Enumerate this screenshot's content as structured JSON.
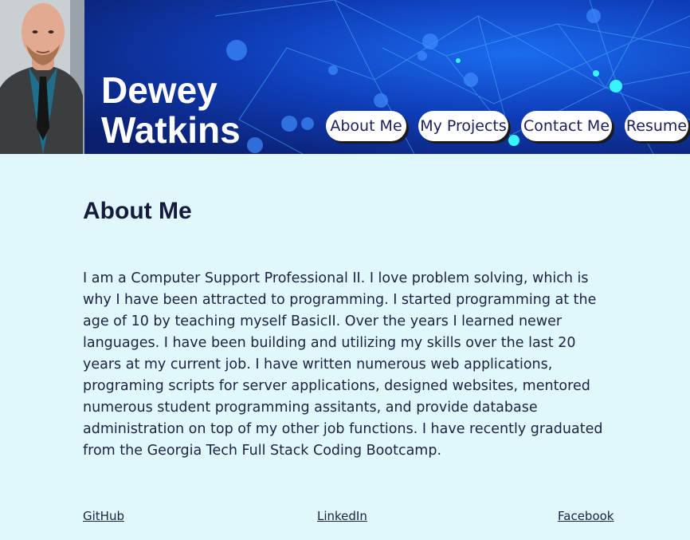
{
  "header": {
    "name_line1": "Dewey",
    "name_line2": "Watkins",
    "avatar_icon": "profile-photo",
    "colors": {
      "banner": "#0a2d8c",
      "nav_button_bg": "#ffffff",
      "page_bg": "#e0f8fc"
    }
  },
  "nav": {
    "items": [
      {
        "label": "About Me"
      },
      {
        "label": "My Projects"
      },
      {
        "label": "Contact Me"
      },
      {
        "label": "Resume"
      }
    ]
  },
  "main": {
    "title": "About Me",
    "bio": "I am a Computer Support Professional II. I love problem solving, which is why I have been attracted to programming. I started programming at the age of 10 by teaching myself BasicII. Over the years I learned newer languages. I have been building and utilizing my skills over the last 20 years at my current job. I have written numerous web applications, programing scripts for server applications, designed websites, mentored numerous student programming assitants, and provide database administration on top of my other job functions. I have recently graduated from the Georgia Tech Full Stack Coding Bootcamp."
  },
  "footer": {
    "links": [
      {
        "label": "GitHub"
      },
      {
        "label": "LinkedIn"
      },
      {
        "label": "Facebook"
      }
    ]
  }
}
